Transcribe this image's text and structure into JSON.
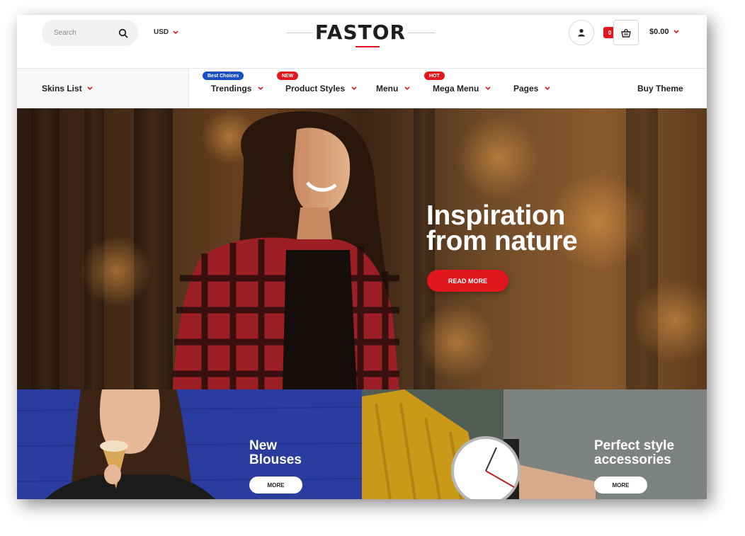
{
  "header": {
    "search": {
      "placeholder": "Search"
    },
    "currency": "USD",
    "logo": "FASTOR",
    "cart": {
      "count": "0",
      "total": "$0.00"
    }
  },
  "nav": {
    "skins_label": "Skins List",
    "items": [
      {
        "label": "Trendings",
        "badge": "Best Choices"
      },
      {
        "label": "Product Styles",
        "badge": "NEW"
      },
      {
        "label": "Menu",
        "badge": ""
      },
      {
        "label": "Mega Menu",
        "badge": "HOT"
      },
      {
        "label": "Pages",
        "badge": ""
      }
    ],
    "buy_theme": "Buy Theme"
  },
  "hero": {
    "title_line1": "Inspiration",
    "title_line2": "from nature",
    "button": "READ MORE"
  },
  "banners": [
    {
      "title_line1": "New",
      "title_line2": "Blouses",
      "button": "MORE"
    },
    {
      "title_line1": "Perfect style",
      "title_line2": "accessories",
      "button": "MORE"
    }
  ],
  "colors": {
    "accent": "#e0171c",
    "badge_blue": "#1a4fc4",
    "banner_blue": "#2d3ea3"
  },
  "icons": [
    "search-icon",
    "chevron-down-icon",
    "user-icon",
    "basket-icon"
  ]
}
